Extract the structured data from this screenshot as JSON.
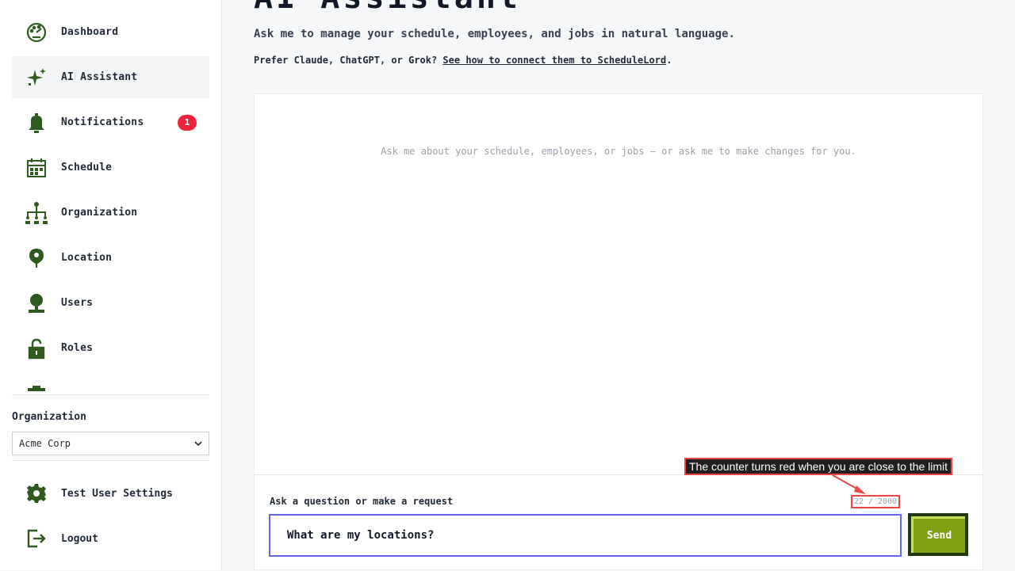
{
  "sidebar": {
    "items": [
      {
        "label": "Dashboard",
        "icon": "dashboard-gauge-icon"
      },
      {
        "label": "AI Assistant",
        "icon": "sparkle-icon",
        "active": true
      },
      {
        "label": "Notifications",
        "icon": "bell-icon",
        "badge": "1"
      },
      {
        "label": "Schedule",
        "icon": "calendar-icon"
      },
      {
        "label": "Organization",
        "icon": "org-chart-icon"
      },
      {
        "label": "Location",
        "icon": "map-pin-icon"
      },
      {
        "label": "Users",
        "icon": "user-icon"
      },
      {
        "label": "Roles",
        "icon": "lock-icon"
      }
    ],
    "organization": {
      "label": "Organization",
      "selected": "Acme Corp"
    },
    "settings_label": "Test User Settings",
    "logout_label": "Logout"
  },
  "main": {
    "title": "AI Assistant",
    "subtitle": "Ask me to manage your schedule, employees, and jobs in natural language.",
    "prefer_text": "Prefer Claude, ChatGPT, or Grok? ",
    "prefer_link": "See how to connect them to ScheduleLord",
    "prefer_end": ".",
    "chat": {
      "empty_text": "Ask me about your schedule, employees, or jobs — or ask me to make changes for you."
    },
    "composer": {
      "label": "Ask a question or make a request",
      "counter": "22 / 2000",
      "input_value": "What are my locations?",
      "send_label": "Send"
    }
  },
  "annotation": {
    "tooltip": "The counter turns red when you are close to the limit"
  },
  "colors": {
    "icon_green": "#2f5a1e",
    "badge_red": "#ef233c",
    "input_focus": "#6366f1",
    "send_green": "#7ea114",
    "send_dark": "#1f3a12",
    "annotation_red": "#ef4444"
  }
}
